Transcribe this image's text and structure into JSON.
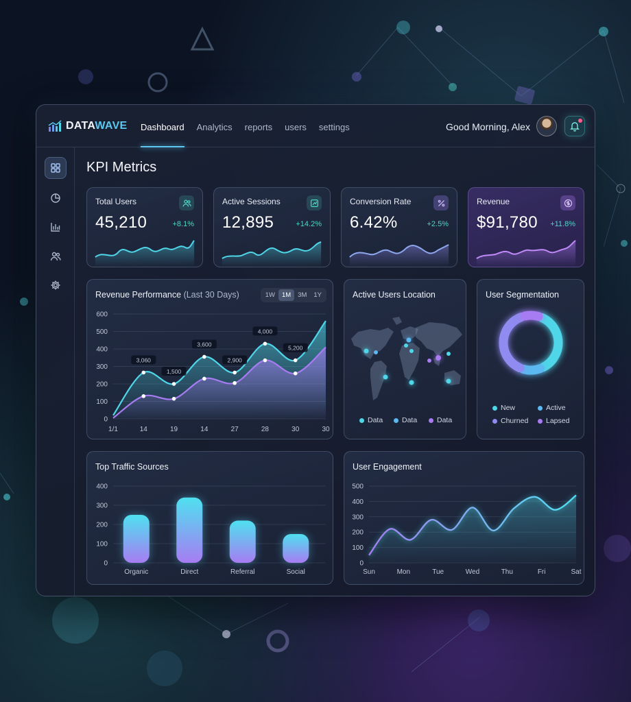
{
  "app": {
    "brand_prefix": "DATA",
    "brand_suffix": "WAVE",
    "greeting": "Good Morning, Alex"
  },
  "nav": [
    {
      "label": "Dashboard",
      "active": true
    },
    {
      "label": "Analytics",
      "active": false
    },
    {
      "label": "reports",
      "active": false
    },
    {
      "label": "users",
      "active": false
    },
    {
      "label": "settings",
      "active": false
    }
  ],
  "sidebar": {
    "items": [
      "grid-icon",
      "pie-chart-icon",
      "bar-chart-icon",
      "users-icon",
      "gear-icon"
    ],
    "bottom": "logout-icon"
  },
  "page_title": "KPI Metrics",
  "kpis": [
    {
      "label": "Total Users",
      "value": "45,210",
      "change": "+8.1%",
      "icon": "users-icon",
      "color": "#4fd6c8"
    },
    {
      "label": "Active Sessions",
      "value": "12,895",
      "change": "+14.2%",
      "icon": "sessions-icon",
      "color": "#4fd6c8"
    },
    {
      "label": "Conversion Rate",
      "value": "6.42%",
      "change": "+2.5%",
      "icon": "percent-icon",
      "color": "#9d7ff0"
    },
    {
      "label": "Revenue",
      "value": "$91,780",
      "change": "+11.8%",
      "icon": "dollar-icon",
      "color": "#b07cf5"
    }
  ],
  "revenue_panel": {
    "title": "Revenue Performance",
    "subtitle": "(Last 30 Days)",
    "ranges": [
      "1W",
      "1M",
      "3M",
      "1Y"
    ],
    "active_range": "1M"
  },
  "location_panel": {
    "title": "Active Users Location",
    "legend": [
      "Data",
      "Data",
      "Data"
    ]
  },
  "segmentation_panel": {
    "title": "User Segmentation",
    "legend": [
      "New",
      "Active",
      "Churned",
      "Lapsed"
    ]
  },
  "traffic_panel": {
    "title": "Top Traffic Sources"
  },
  "engagement_panel": {
    "title": "User Engagement"
  },
  "colors": {
    "cyan": "#4fd6e8",
    "purple": "#a77cf2",
    "teal": "#4fd6c8"
  },
  "chart_data": [
    {
      "type": "area",
      "title": "Revenue Performance (Last 30 Days)",
      "categories": [
        "1/1",
        "14",
        "19",
        "14",
        "27",
        "28",
        "30",
        "30"
      ],
      "yticks": [
        0,
        100,
        200,
        300,
        400,
        500,
        600
      ],
      "ylim": [
        0,
        600
      ],
      "series": [
        {
          "values": [
            20,
            265,
            200,
            355,
            265,
            430,
            335,
            560
          ]
        },
        {
          "values": [
            5,
            130,
            115,
            230,
            205,
            335,
            260,
            410
          ]
        }
      ],
      "annotations": [
        {
          "category_index": 1,
          "series": 0,
          "label": "3,060"
        },
        {
          "category_index": 2,
          "series": 0,
          "label": "1,500"
        },
        {
          "category_index": 3,
          "series": 0,
          "label": "3,600"
        },
        {
          "category_index": 4,
          "series": 0,
          "label": "2,900"
        },
        {
          "category_index": 5,
          "series": 0,
          "label": "4,000"
        },
        {
          "category_index": 6,
          "series": 0,
          "label": "5,200"
        }
      ]
    },
    {
      "type": "pie",
      "title": "User Segmentation",
      "slices": [
        {
          "name": "New",
          "value": 38
        },
        {
          "name": "Active",
          "value": 12
        },
        {
          "name": "Churned",
          "value": 40
        },
        {
          "name": "Lapsed",
          "value": 10
        }
      ]
    },
    {
      "type": "bar",
      "title": "Top Traffic Sources",
      "categories": [
        "Organic",
        "Direct",
        "Referral",
        "Social"
      ],
      "values": [
        250,
        340,
        220,
        150
      ],
      "yticks": [
        0,
        100,
        200,
        300,
        400
      ],
      "ylim": [
        0,
        400
      ]
    },
    {
      "type": "line",
      "title": "User Engagement",
      "categories": [
        "Sun",
        "Mon",
        "Tue",
        "Wed",
        "Thu",
        "Fri",
        "Sat"
      ],
      "values": [
        50,
        220,
        150,
        280,
        215,
        360,
        210,
        355,
        430,
        345,
        440
      ],
      "yticks": [
        0,
        100,
        200,
        300,
        400,
        500
      ],
      "ylim": [
        0,
        500
      ]
    }
  ]
}
